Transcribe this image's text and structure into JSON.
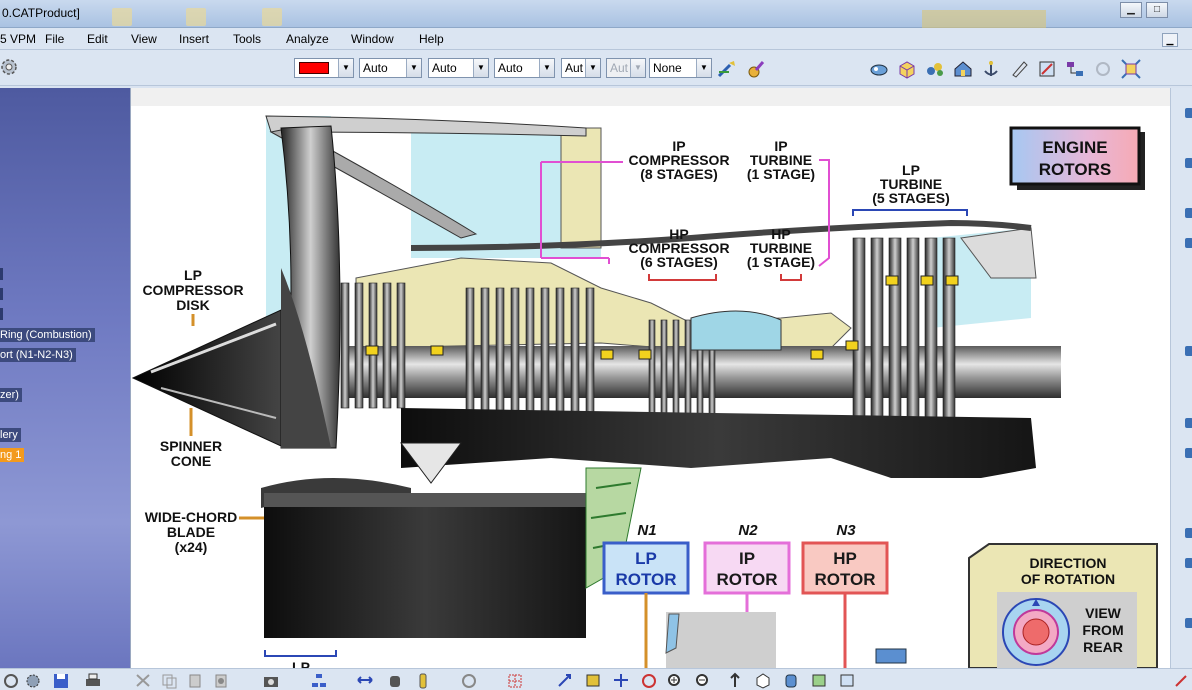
{
  "window": {
    "title": "0.CATProduct]",
    "minimize": "▁",
    "maximize": "□"
  },
  "menubar": {
    "prefix": "5 VPM",
    "items": [
      "File",
      "Edit",
      "View",
      "Insert",
      "Tools",
      "Analyze",
      "Window",
      "Help"
    ]
  },
  "toolbar": {
    "color_swatch": "#ff0000",
    "combos": [
      "Auto",
      "Auto",
      "Auto",
      "Aut",
      "Aut",
      "None"
    ]
  },
  "tree": {
    "items": [
      "Ring (Combustion)",
      "ort (N1-N2-N3)",
      "zer)",
      "lery",
      "ng 1"
    ],
    "selected_index": 4
  },
  "diagram": {
    "title_box": [
      "ENGINE",
      "ROTORS"
    ],
    "labels": {
      "ip_compressor": [
        "IP",
        "COMPRESSOR",
        "(8 STAGES)"
      ],
      "ip_turbine": [
        "IP",
        "TURBINE",
        "(1 STAGE)"
      ],
      "lp_turbine": [
        "LP",
        "TURBINE",
        "(5 STAGES)"
      ],
      "hp_compressor": [
        "HP",
        "COMPRESSOR",
        "(6 STAGES)"
      ],
      "hp_turbine": [
        "HP",
        "TURBINE",
        "(1 STAGE)"
      ],
      "lp_compressor_disk": [
        "LP",
        "COMPRESSOR",
        "DISK"
      ],
      "spinner_cone": [
        "SPINNER",
        "CONE"
      ],
      "wide_chord_blade": [
        "WIDE-CHORD",
        "BLADE",
        "(x24)"
      ],
      "bottom_lp": "LP"
    },
    "rotors": [
      {
        "n": "N1",
        "line1": "LP",
        "line2": "ROTOR",
        "color": "#3a5ec9",
        "fill": "#c9e3f7",
        "text": "#1a3aa8"
      },
      {
        "n": "N2",
        "line1": "IP",
        "line2": "ROTOR",
        "color": "#e46fd9",
        "fill": "#f7d9f3",
        "text": "#1a1a1a"
      },
      {
        "n": "N3",
        "line1": "HP",
        "line2": "ROTOR",
        "color": "#e25555",
        "fill": "#f9c9c2",
        "text": "#1a1a1a"
      }
    ],
    "direction": [
      "DIRECTION",
      "OF ROTATION"
    ],
    "view_from_rear": [
      "VIEW",
      "FROM",
      "REAR"
    ]
  },
  "colors": {
    "panel_bg": "#dbe5f2",
    "tree_bg": "#5b66ad",
    "tree_selected": "#f39a1d",
    "casing": "#ebe6b4",
    "sky": "#c8ecf3"
  }
}
